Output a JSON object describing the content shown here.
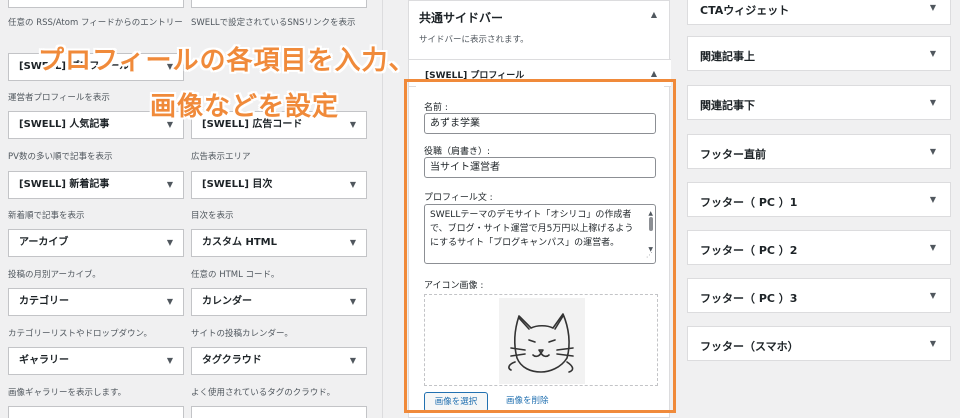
{
  "available_widgets": [
    {
      "col": 1,
      "top_desc": "任意の RSS/Atom フィードからのエントリー"
    },
    {
      "col": 2,
      "top_desc": "SWELLで設定されているSNSリンクを表示"
    },
    {
      "col": 1,
      "label": "[SWELL] プロフィール",
      "desc": "運営者プロフィールを表示"
    },
    {
      "col": 1,
      "label": "[SWELL] 人気記事",
      "desc": "PV数の多い順で記事を表示"
    },
    {
      "col": 2,
      "label": "[SWELL] 広告コード",
      "desc": "広告表示エリア"
    },
    {
      "col": 1,
      "label": "[SWELL] 新着記事",
      "desc": "新着順で記事を表示"
    },
    {
      "col": 2,
      "label": "[SWELL] 目次",
      "desc": "目次を表示"
    },
    {
      "col": 1,
      "label": "アーカイブ",
      "desc": "投稿の月別アーカイブ。"
    },
    {
      "col": 2,
      "label": "カスタム HTML",
      "desc": "任意の HTML コード。"
    },
    {
      "col": 1,
      "label": "カテゴリー",
      "desc": "カテゴリーリストやドロップダウン。"
    },
    {
      "col": 2,
      "label": "カレンダー",
      "desc": "サイトの投稿カレンダー。"
    },
    {
      "col": 1,
      "label": "ギャラリー",
      "desc": "画像ギャラリーを表示します。"
    },
    {
      "col": 2,
      "label": "タグクラウド",
      "desc": "よく使用されているタグのクラウド。"
    }
  ],
  "arrow_glyph": "▼",
  "collapse_glyph": "▲",
  "sidebar": {
    "title": "共通サイドバー",
    "desc": "サイドバーに表示されます。",
    "widget_title": "[SWELL] プロフィール",
    "fields": {
      "name_label": "名前 :",
      "name_value": "あずま学業",
      "role_label": "役職（肩書き）:",
      "role_value": "当サイト運営者",
      "profile_label": "プロフィール文 :",
      "profile_value": "SWELLテーマのデモサイト「オシリコ」の作成者で、ブログ・サイト運営で月5万円以上稼げるようにするサイト「ブログキャンパス」の運営者。",
      "icon_label": "アイコン画像 :",
      "select_image": "画像を選択",
      "remove_image": "画像を削除"
    }
  },
  "widget_areas": [
    "CTAウィジェット",
    "関連記事上",
    "関連記事下",
    "フッター直前",
    "フッター（ PC ）1",
    "フッター（ PC ）2",
    "フッター（ PC ）3",
    "フッター（スマホ）"
  ],
  "callout": {
    "line1": "プロフィールの各項目を入力、",
    "line2": "画像などを設定"
  },
  "colors": {
    "accent": "#f08a3a",
    "link": "#2271b1"
  }
}
